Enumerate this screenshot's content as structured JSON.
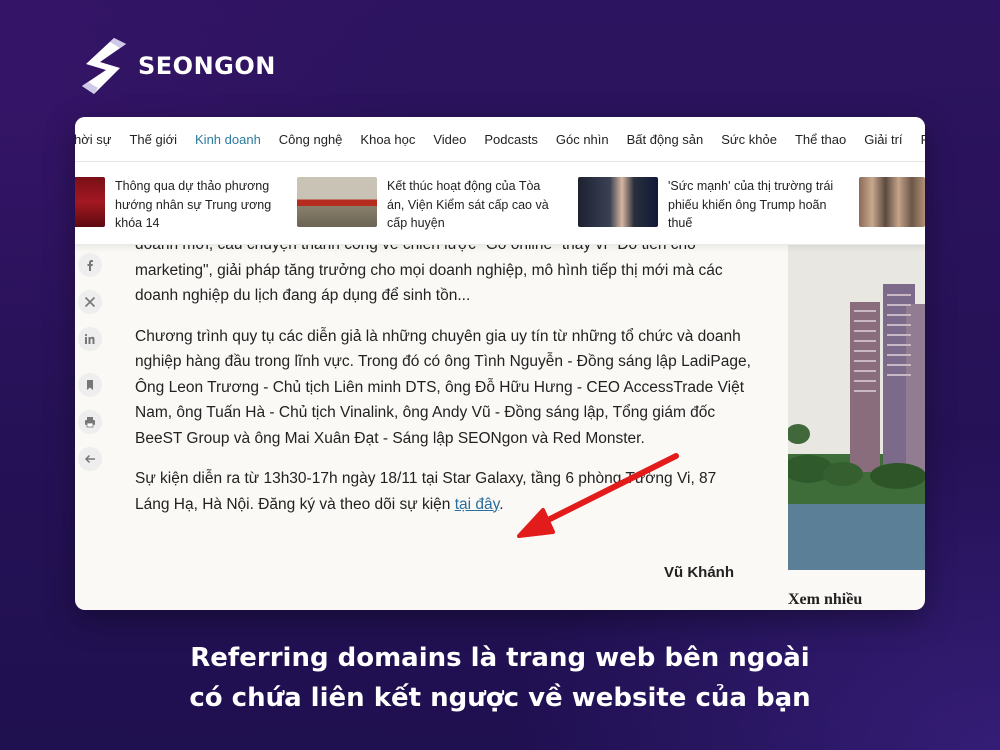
{
  "brand": {
    "name": "SEONGON"
  },
  "nav": {
    "items": [
      "hời sự",
      "Thế giới",
      "Kinh doanh",
      "Công nghệ",
      "Khoa học",
      "Video",
      "Podcasts",
      "Góc nhìn",
      "Bất động sản",
      "Sức khỏe",
      "Thể thao",
      "Giải trí",
      "P"
    ],
    "active": "Kinh doanh"
  },
  "news_strip": [
    {
      "text": "Thông qua dự thảo phương hướng nhân sự Trung ương khóa 14"
    },
    {
      "text": "Kết thúc hoạt động của Tòa án, Viện Kiểm sát cấp cao và cấp huyện"
    },
    {
      "text": "'Sức mạnh' của thị trường trái phiếu khiến ông Trump hoãn thuế"
    },
    {
      "text": ""
    }
  ],
  "share_icons": [
    "facebook-icon",
    "x-icon",
    "linkedin-icon",
    "bookmark-icon",
    "print-icon",
    "back-arrow-icon"
  ],
  "article": {
    "p0": "doanh mới, câu chuyện thành công về chiến lược \"Go online\" thay vì \"Đổ tiền cho marketing\", giải pháp tăng trưởng cho mọi doanh nghiệp, mô hình tiếp thị mới mà các doanh nghiệp du lịch đang áp dụng để sinh tồn...",
    "p1": "Chương trình quy tụ các diễn giả là những chuyên gia uy tín từ những tổ chức và doanh nghiệp hàng đầu trong lĩnh vực. Trong đó có ông Tình Nguyễn - Đồng sáng lập LadiPage, Ông Leon Trương - Chủ tịch Liên minh DTS, ông Đỗ Hữu Hưng - CEO AccessTrade Việt Nam, ông Tuấn Hà - Chủ tịch Vinalink, ông Andy Vũ - Đồng sáng lập, Tổng giám đốc BeeST Group và ông Mai Xuân Đạt - Sáng lập SEONgon và Red Monster.",
    "p2_text": "Sự kiện diễn ra từ 13h30-17h ngày 18/11 tại Star Galaxy, tầng 6 phòng Tường Vi, 87 Láng Hạ, Hà Nội. Đăng ký và theo dõi sự kiện ",
    "p2_link": "tại đây",
    "p2_end": ".",
    "author": "Vũ Khánh"
  },
  "sidebar": {
    "heading": "Xem nhiều"
  },
  "caption": {
    "line1": "Referring domains là trang web bên ngoài",
    "line2": "có chứa liên kết ngược về website của bạn"
  },
  "colors": {
    "accent": "#2b7a9e",
    "arrow": "#e21b1b",
    "background": "#2a1259"
  }
}
